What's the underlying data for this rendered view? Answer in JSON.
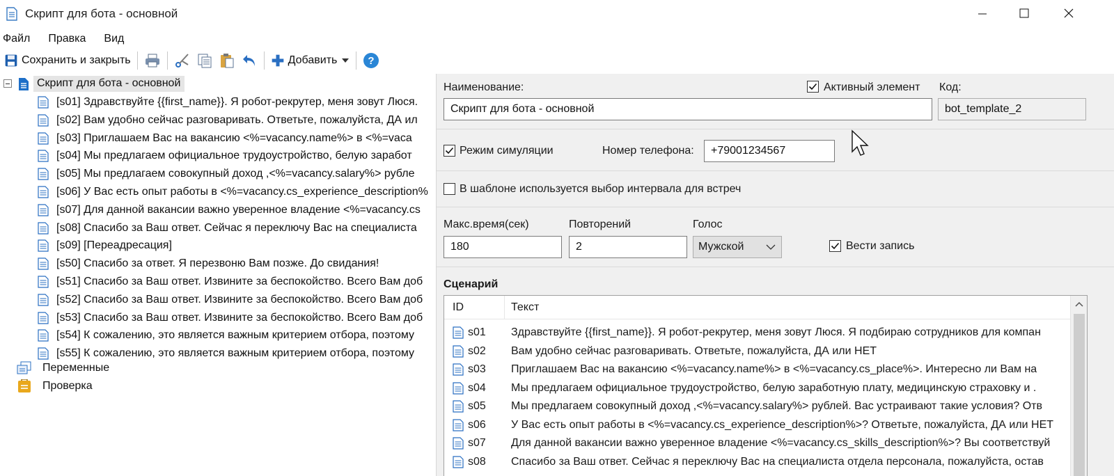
{
  "window": {
    "title": "Скрипт для бота - основной"
  },
  "menu": [
    {
      "label": "Файл"
    },
    {
      "label": "Правка"
    },
    {
      "label": "Вид"
    }
  ],
  "toolbar": {
    "save_label": "Сохранить и закрыть",
    "add_label": "Добавить"
  },
  "tree": {
    "root": "Скрипт для бота - основной",
    "items": [
      "[s01] Здравствуйте {{first_name}}. Я робот-рекрутер, меня зовут Люся.",
      "[s02] Вам удобно сейчас разговаривать. Ответьте, пожалуйста, ДА ил",
      "[s03] Приглашаем Вас на вакансию <%=vacancy.name%> в <%=vaca",
      "[s04] Мы предлагаем официальное трудоустройство, белую заработ",
      "[s05] Мы предлагаем совокупный доход ,<%=vacancy.salary%> рубле",
      "[s06] У Вас есть опыт работы в <%=vacancy.cs_experience_description%",
      "[s07] Для данной вакансии важно уверенное владение <%=vacancy.cs",
      "[s08] Спасибо за Ваш ответ. Сейчас я переключу Вас на специалиста",
      "[s09] [Переадресация]",
      "[s50] Спасибо за ответ. Я перезвоню Вам позже. До свидания!",
      "[s51] Спасибо за Ваш ответ. Извините за беспокойство. Всего Вам доб",
      "[s52] Спасибо за Ваш ответ. Извините за беспокойство. Всего Вам доб",
      "[s53] Спасибо за Ваш ответ. Извините за беспокойство. Всего Вам доб",
      "[s54] К сожалению, это является важным критерием отбора, поэтому",
      "[s55] К сожалению, это является важным критерием отбора, поэтому"
    ],
    "variables": "Переменные",
    "check": "Проверка"
  },
  "form": {
    "name_label": "Наименование:",
    "name_value": "Скрипт для бота - основной",
    "active_label": "Активный элемент",
    "active_checked": true,
    "code_label": "Код:",
    "code_value": "bot_template_2",
    "sim_label": "Режим симуляции",
    "sim_checked": true,
    "phone_label": "Номер телефона:",
    "phone_value": "+79001234567",
    "interval_label": "В шаблоне используется выбор интервала для встреч",
    "interval_checked": false,
    "maxtime_label": "Макс.время(сек)",
    "maxtime_value": "180",
    "repeat_label": "Повторений",
    "repeat_value": "2",
    "voice_label": "Голос",
    "voice_value": "Мужской",
    "record_label": "Вести запись",
    "record_checked": true
  },
  "scenario": {
    "title": "Сценарий",
    "col_id": "ID",
    "col_text": "Текст",
    "rows": [
      {
        "id": "s01",
        "text": "Здравствуйте {{first_name}}. Я робот-рекрутер, меня зовут Люся. Я подбираю сотрудников для компан"
      },
      {
        "id": "s02",
        "text": "Вам удобно сейчас разговаривать. Ответьте, пожалуйста, ДА или НЕТ"
      },
      {
        "id": "s03",
        "text": "Приглашаем Вас на вакансию <%=vacancy.name%> в <%=vacancy.cs_place%>. Интересно ли Вам на"
      },
      {
        "id": "s04",
        "text": "Мы предлагаем официальное трудоустройство, белую заработную плату, медицинскую страховку и ."
      },
      {
        "id": "s05",
        "text": "Мы предлагаем совокупный доход ,<%=vacancy.salary%> рублей. Вас устраивают такие условия? Отв"
      },
      {
        "id": "s06",
        "text": "У Вас есть опыт работы в <%=vacancy.cs_experience_description%>? Ответьте, пожалуйста, ДА или НЕТ"
      },
      {
        "id": "s07",
        "text": "Для данной вакансии важно уверенное владение <%=vacancy.cs_skills_description%>? Вы соответствуй"
      },
      {
        "id": "s08",
        "text": "Спасибо за Ваш ответ. Сейчас я переключу Вас на специалиста отдела персонала, пожалуйста, остав"
      }
    ]
  },
  "colors": {
    "panel_bg": "#f0f0f0",
    "accent_blue": "#1e73c8",
    "selection": "#e5e5e5"
  }
}
